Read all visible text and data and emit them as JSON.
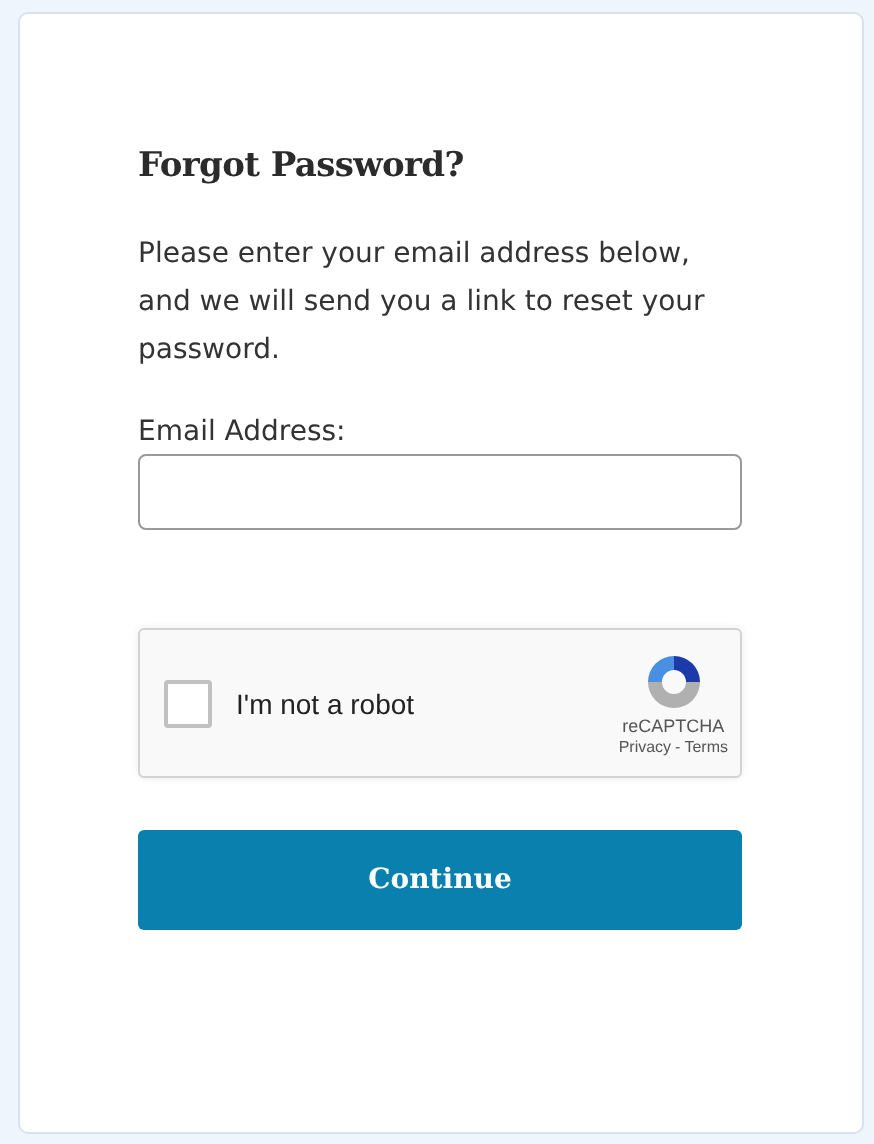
{
  "title": "Forgot Password?",
  "instructions": "Please enter your email address below, and we will send you a link to reset your password.",
  "email_field": {
    "label": "Email Address:"
  },
  "captcha": {
    "checked": false,
    "label": "I'm not a robot",
    "brand": "reCAPTCHA",
    "links": [
      "Privacy",
      "Terms"
    ],
    "separator": "-"
  },
  "submit_button": "Continue"
}
